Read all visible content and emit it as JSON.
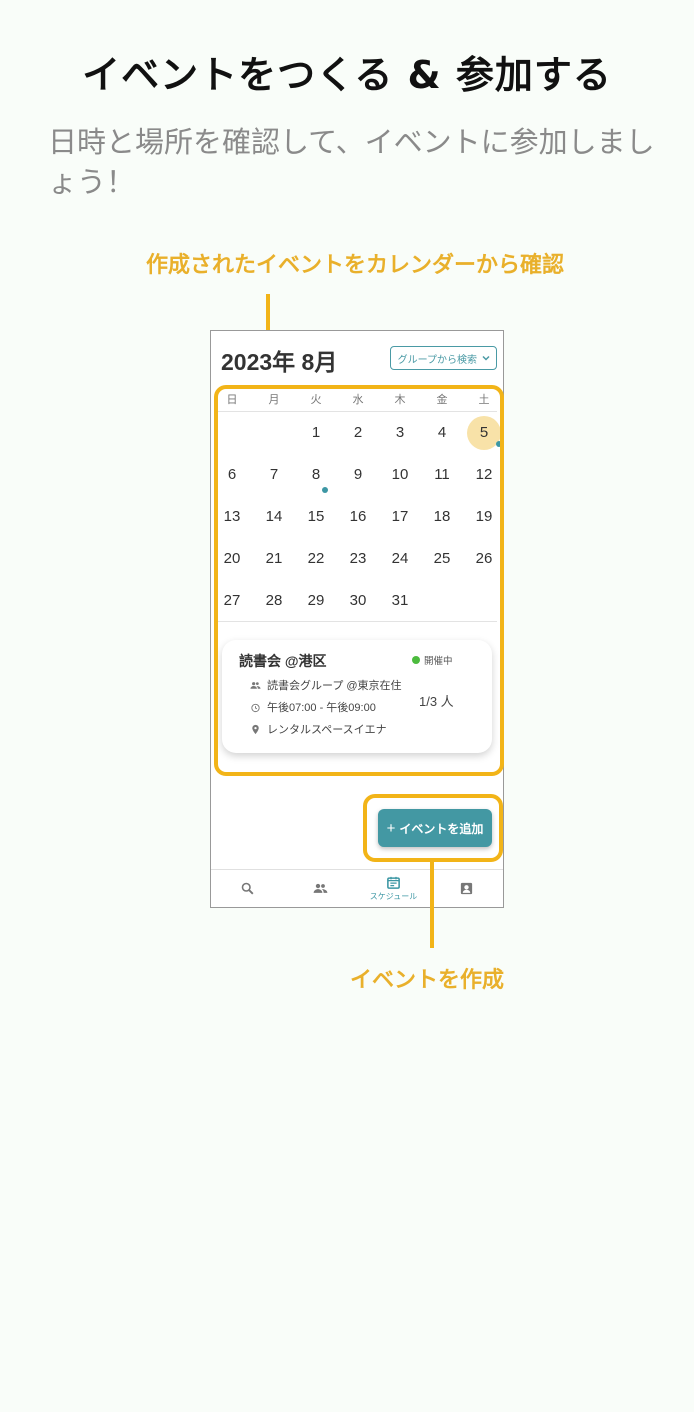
{
  "headline": "イベントをつくる & 参加する",
  "subline": "日時と場所を確認して、イベントに参加しましょう！",
  "annotations": {
    "calendar": "作成されたイベントをカレンダーから確認",
    "create": "イベントを作成"
  },
  "app": {
    "month_title": "2023年 8月",
    "group_search_label": "グループから検索",
    "weekdays": [
      "日",
      "月",
      "火",
      "水",
      "木",
      "金",
      "土"
    ],
    "days": [
      "",
      "",
      "1",
      "2",
      "3",
      "4",
      "5",
      "6",
      "7",
      "8",
      "9",
      "10",
      "11",
      "12",
      "13",
      "14",
      "15",
      "16",
      "17",
      "18",
      "19",
      "20",
      "21",
      "22",
      "23",
      "24",
      "25",
      "26",
      "27",
      "28",
      "29",
      "30",
      "31"
    ],
    "today": "5",
    "event_days": [
      "5",
      "8"
    ],
    "event": {
      "title": "読書会 @港区",
      "status": "開催中",
      "group": "読書会グループ @東京在住",
      "time": "午後07:00 - 午後09:00",
      "place": "レンタルスペースイエナ",
      "count": "1/3 人"
    },
    "add_button_label": "イベントを追加",
    "nav": [
      {
        "icon": "search-icon",
        "label": ""
      },
      {
        "icon": "people-icon",
        "label": ""
      },
      {
        "icon": "calendar-icon",
        "label": "スケジュール"
      },
      {
        "icon": "profile-icon",
        "label": ""
      }
    ]
  },
  "colors": {
    "accent": "#4398a3",
    "highlight": "#f2b418",
    "annotation_text": "#e9b02b",
    "today_circle": "#f8e2a8",
    "status_green": "#4cbb3e"
  }
}
